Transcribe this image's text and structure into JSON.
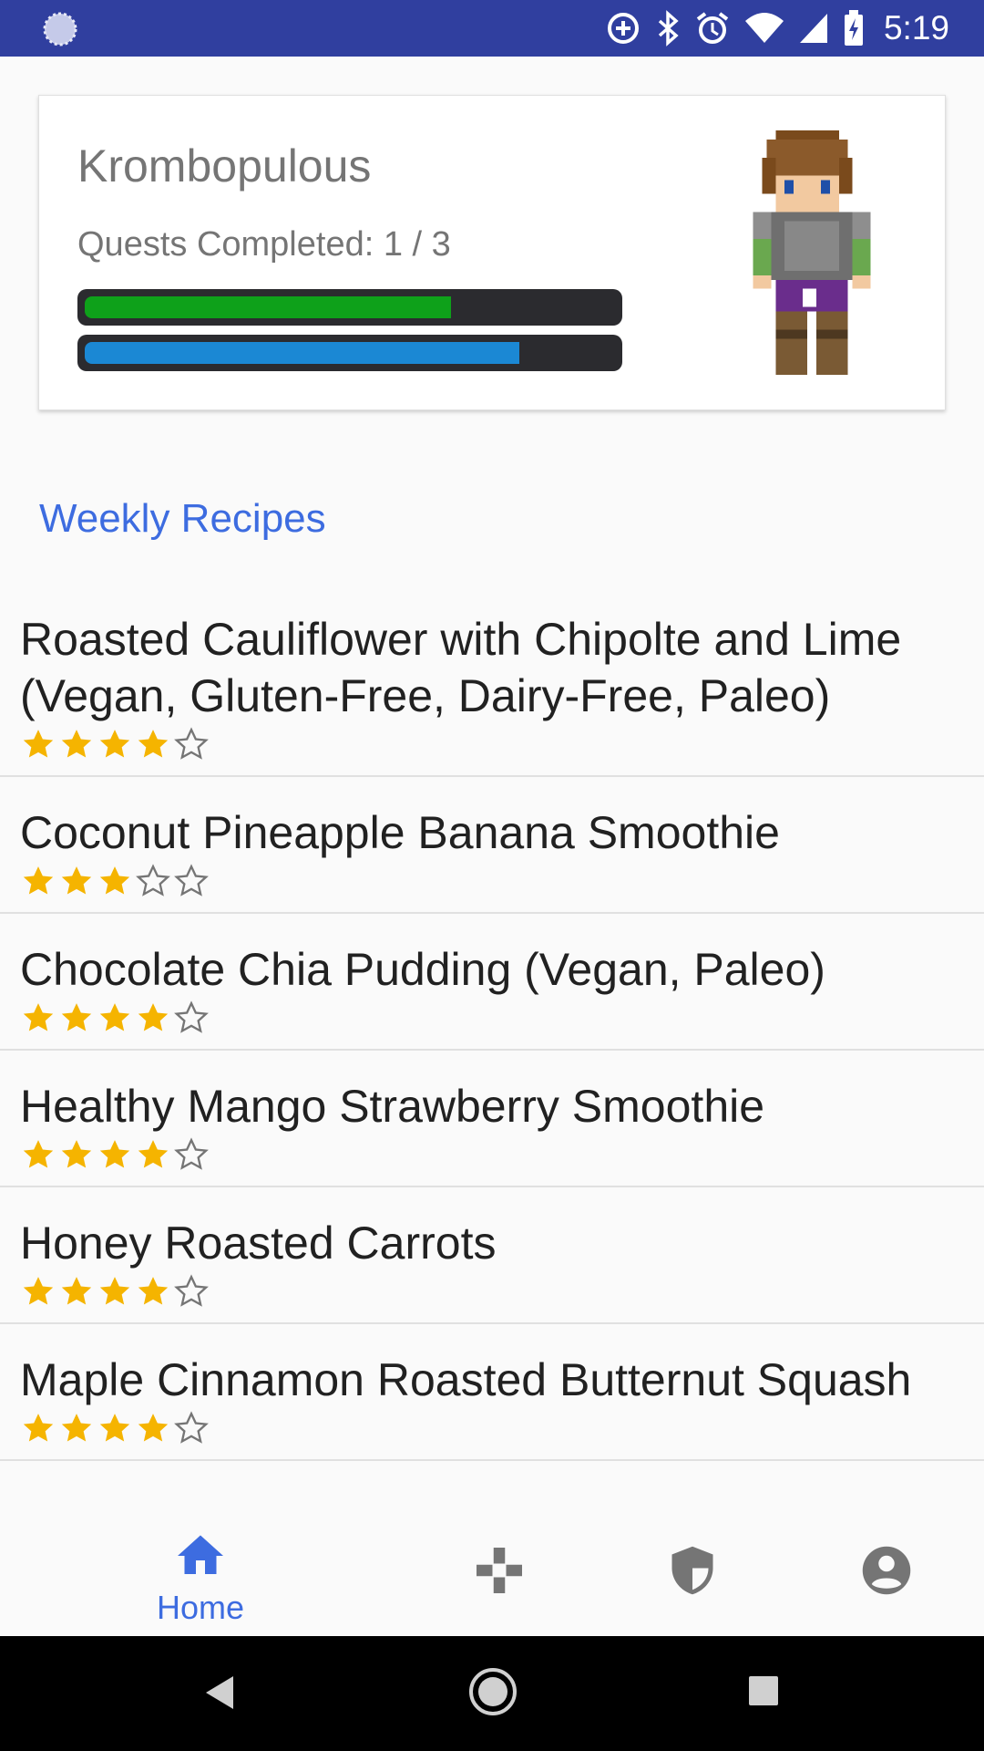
{
  "status_bar": {
    "time": "5:19"
  },
  "profile": {
    "username": "Krombopulous",
    "quests_label": "Quests Completed: 1 / 3",
    "health_fraction": 0.69,
    "experience_fraction": 0.82,
    "colors": {
      "health": "#0ea11a",
      "experience": "#1b88d4"
    }
  },
  "section": {
    "title": "Weekly Recipes"
  },
  "recipes": [
    {
      "title": "Roasted Cauliflower with Chipolte and Lime (Vegan, Gluten-Free, Dairy-Free, Paleo)",
      "rating": 4
    },
    {
      "title": "Coconut Pineapple Banana Smoothie",
      "rating": 3
    },
    {
      "title": "Chocolate Chia Pudding (Vegan, Paleo)",
      "rating": 4
    },
    {
      "title": "Healthy Mango Strawberry Smoothie",
      "rating": 4
    },
    {
      "title": "Honey Roasted Carrots",
      "rating": 4
    },
    {
      "title": "Maple Cinnamon Roasted Butternut Squash",
      "rating": 4
    }
  ],
  "bottom_nav": {
    "items": [
      {
        "icon": "home-icon",
        "label": "Home",
        "active": true
      },
      {
        "icon": "gamepad-icon",
        "label": "",
        "active": false
      },
      {
        "icon": "shield-icon",
        "label": "",
        "active": false
      },
      {
        "icon": "account-icon",
        "label": "",
        "active": false
      }
    ]
  },
  "colors": {
    "accent": "#3d6ce0",
    "status_bar": "#303f9f",
    "star": "#f5b400"
  }
}
